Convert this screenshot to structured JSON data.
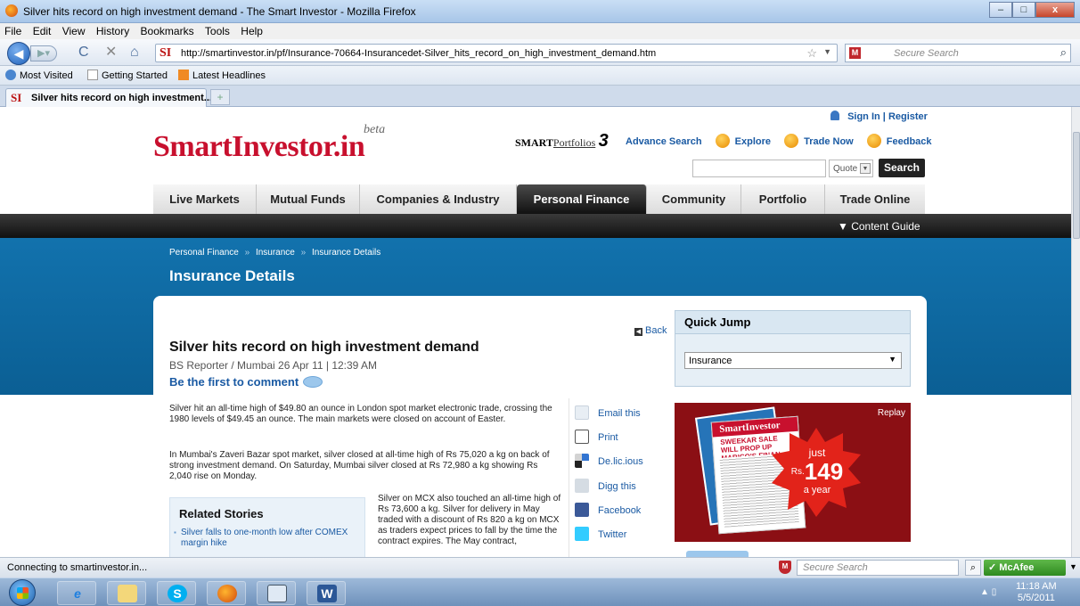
{
  "window": {
    "title": "Silver hits record on high investment demand - The Smart Investor - Mozilla Firefox",
    "minimize": "–",
    "maximize": "□",
    "close": "x"
  },
  "menubar": [
    "File",
    "Edit",
    "View",
    "History",
    "Bookmarks",
    "Tools",
    "Help"
  ],
  "navbar": {
    "url": "http://smartinvestor.in/pf/Insurance-70664-Insurancedet-Silver_hits_record_on_high_investment_demand.htm",
    "site_icon": "SI",
    "search_placeholder": "Secure Search"
  },
  "bookmarks": [
    "Most Visited",
    "Getting Started",
    "Latest Headlines"
  ],
  "tab": {
    "site_icon": "SI",
    "title": "Silver hits record on high investment...",
    "new_tab": "+"
  },
  "site": {
    "logo": "SmartInvestor.in",
    "beta": "beta",
    "sign_in": "Sign In",
    "register": "Register",
    "smart_portfolios": {
      "smart": "SMART",
      "portfolios": "Portfolios",
      "version": "3"
    },
    "top_links": [
      "Advance Search",
      "Explore",
      "Trade Now",
      "Feedback"
    ],
    "quote_placeholder": "",
    "quote_select": "Quote",
    "search_button": "Search",
    "nav": [
      "Live Markets",
      "Mutual Funds",
      "Companies & Industry",
      "Personal Finance",
      "Community",
      "Portfolio",
      "Trade Online"
    ],
    "active_nav": "Personal Finance",
    "content_guide": "▼ Content Guide"
  },
  "breadcrumb": [
    "Personal Finance",
    "Insurance",
    "Insurance Details"
  ],
  "breadcrumb_sep": "»",
  "page_title": "Insurance Details",
  "article": {
    "back": "Back",
    "title": "Silver hits record on high investment demand",
    "byline": "BS Reporter / Mumbai 26 Apr 11 | 12:39 AM",
    "first_comment": "Be the first to comment",
    "p1": "Silver hit an all-time high of $49.80 an ounce in London spot market electronic trade, crossing the 1980 levels of $49.45 an ounce. The main markets were closed on account of Easter.",
    "p2": "In Mumbai's Zaveri Bazar spot market, silver closed at all-time high of Rs 75,020 a kg on back of strong investment demand. On Saturday, Mumbai silver closed at Rs 72,980 a kg showing Rs 2,040 rise on Monday.",
    "p3": "Silver on MCX also touched an all-time high of Rs 73,600 a kg. Silver for delivery in May traded with a discount of Rs 820 a kg on MCX as traders expect prices to fall by the time the contract expires. The May contract,"
  },
  "related": {
    "heading": "Related Stories",
    "items": [
      "Silver falls to one-month low after COMEX margin hike"
    ]
  },
  "share": [
    "Email this",
    "Print",
    "De.lic.ious",
    "Digg this",
    "Facebook",
    "Twitter"
  ],
  "quick_jump": {
    "heading": "Quick Jump",
    "selected": "Insurance"
  },
  "ad": {
    "replay": "Replay",
    "brand": "SmartInvestor",
    "headline": "SWEEKAR SALE WILL PROP UP MARICO'S FINAN",
    "just": "just",
    "rs": "Rs.",
    "price": "149",
    "a_year": "a year"
  },
  "statusbar": {
    "text": "Connecting to smartinvestor.in...",
    "search_placeholder": "Secure Search",
    "mcafee": "McAfee"
  },
  "taskbar": {
    "time": "11:18 AM",
    "date": "5/5/2011"
  },
  "colors": {
    "brand_red": "#c8102e",
    "link_blue": "#1a5aa3",
    "band_blue": "#1272ad"
  }
}
